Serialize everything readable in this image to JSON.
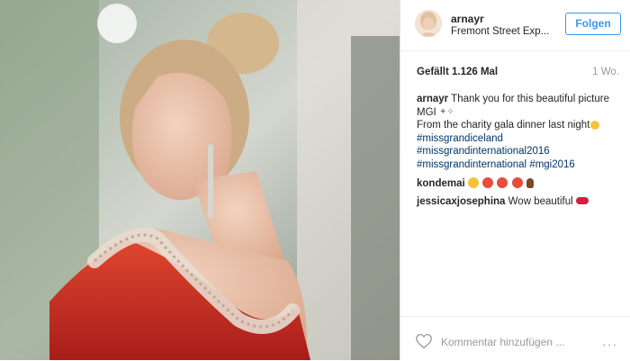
{
  "post": {
    "username": "arnayr",
    "location": "Fremont Street Exp...",
    "follow_label": "Folgen",
    "likes": "Gefällt 1.126 Mal",
    "time": "1 Wo.",
    "caption_user": "arnayr",
    "caption_line1": "Thank you for this beautiful picture",
    "caption_line2": "MGI",
    "caption_line3": "From the charity gala dinner last night",
    "hashtags": [
      "#missgrandiceland",
      "#missgrandinternational2016",
      "#missgrandinternational",
      "#mgi2016"
    ],
    "comments": [
      {
        "user": "kondemai",
        "text": ""
      },
      {
        "user": "jessicaxjosephina",
        "text": "Wow beautiful"
      }
    ],
    "add_comment_placeholder": "Kommentar hinzufügen ...",
    "more_label": "···"
  },
  "icons": [
    "heart-icon",
    "sparkles-icon",
    "smile-emoji",
    "heart-eyes-emoji",
    "lips-emoji",
    "more-options-icon"
  ],
  "colors": {
    "accent": "#3897f0",
    "hashtag": "#003569",
    "text": "#262626",
    "muted": "#999999"
  }
}
